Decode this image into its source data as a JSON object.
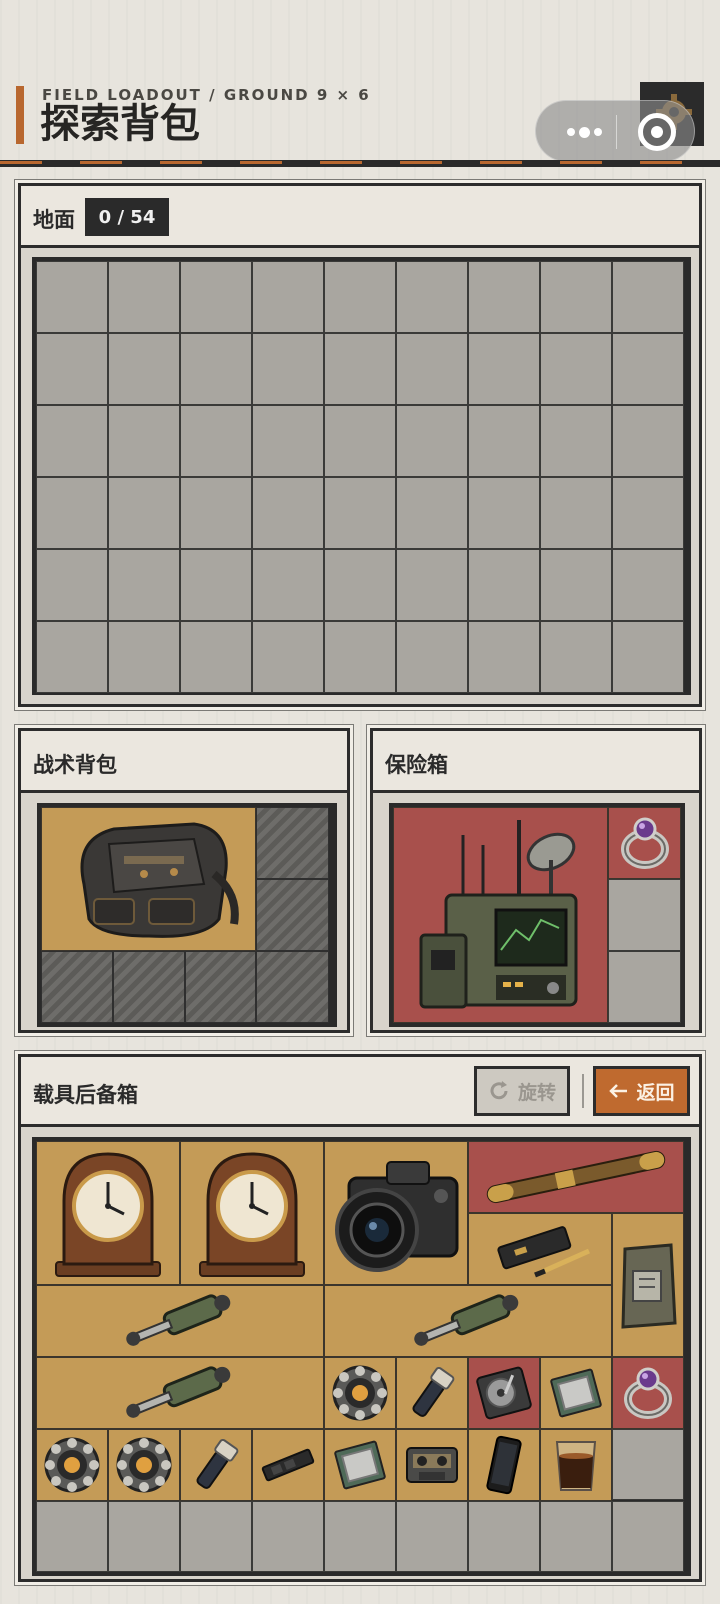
{
  "header": {
    "subtitle": "FIELD LOADOUT / GROUND 9 × 6",
    "title": "探索背包"
  },
  "colors": {
    "accent": "#b8672f",
    "gold_cell": "#c49b57",
    "red_cell": "#a8504c",
    "empty_cell": "#a9a6a0",
    "frame": "#2a2a2a"
  },
  "ground": {
    "title": "地面",
    "count": "0 / 54",
    "columns": 9,
    "rows": 6
  },
  "backpack": {
    "title": "战术背包",
    "items": [
      {
        "name": "tactical-backpack",
        "icon": "backpack-icon",
        "tier": "gold"
      }
    ]
  },
  "safebox": {
    "title": "保险箱",
    "items": [
      {
        "name": "radio-station",
        "icon": "radio-station-icon",
        "tier": "red"
      },
      {
        "name": "gem-ring",
        "icon": "ring-icon",
        "tier": "red"
      }
    ]
  },
  "trunk": {
    "title": "载具后备箱",
    "rotate_label": "旋转",
    "back_label": "返回",
    "items": [
      {
        "name": "mantel-clock-1",
        "icon": "mantel-clock-icon",
        "tier": "gold"
      },
      {
        "name": "mantel-clock-2",
        "icon": "mantel-clock-icon",
        "tier": "gold"
      },
      {
        "name": "dslr-camera",
        "icon": "camera-icon",
        "tier": "gold"
      },
      {
        "name": "ornate-rod",
        "icon": "rod-icon",
        "tier": "red"
      },
      {
        "name": "pen-case",
        "icon": "pen-case-icon",
        "tier": "gold"
      },
      {
        "name": "ration-pack",
        "icon": "pouch-icon",
        "tier": "gold"
      },
      {
        "name": "hydraulic-cylinder-1",
        "icon": "hydraulic-cylinder-icon",
        "tier": "gold"
      },
      {
        "name": "hydraulic-cylinder-2",
        "icon": "hydraulic-cylinder-icon",
        "tier": "gold"
      },
      {
        "name": "hydraulic-cylinder-3",
        "icon": "hydraulic-cylinder-icon",
        "tier": "gold"
      },
      {
        "name": "bearing-1",
        "icon": "bearing-icon",
        "tier": "gold"
      },
      {
        "name": "flashlight-1",
        "icon": "flashlight-icon",
        "tier": "gold"
      },
      {
        "name": "hard-drive",
        "icon": "hard-drive-icon",
        "tier": "red"
      },
      {
        "name": "cpu-chip-1",
        "icon": "cpu-icon",
        "tier": "gold"
      },
      {
        "name": "gem-ring-2",
        "icon": "ring-icon",
        "tier": "red"
      },
      {
        "name": "bearing-2",
        "icon": "bearing-icon",
        "tier": "gold"
      },
      {
        "name": "bearing-3",
        "icon": "bearing-icon",
        "tier": "gold"
      },
      {
        "name": "flashlight-2",
        "icon": "flashlight-icon",
        "tier": "gold"
      },
      {
        "name": "ssd-stick",
        "icon": "ssd-icon",
        "tier": "gold"
      },
      {
        "name": "cpu-chip-2",
        "icon": "cpu-icon",
        "tier": "gold"
      },
      {
        "name": "cassette-tape",
        "icon": "cassette-icon",
        "tier": "gold"
      },
      {
        "name": "smartphone",
        "icon": "phone-icon",
        "tier": "gold"
      },
      {
        "name": "espresso-glass",
        "icon": "espresso-glass-icon",
        "tier": "gold"
      }
    ]
  }
}
